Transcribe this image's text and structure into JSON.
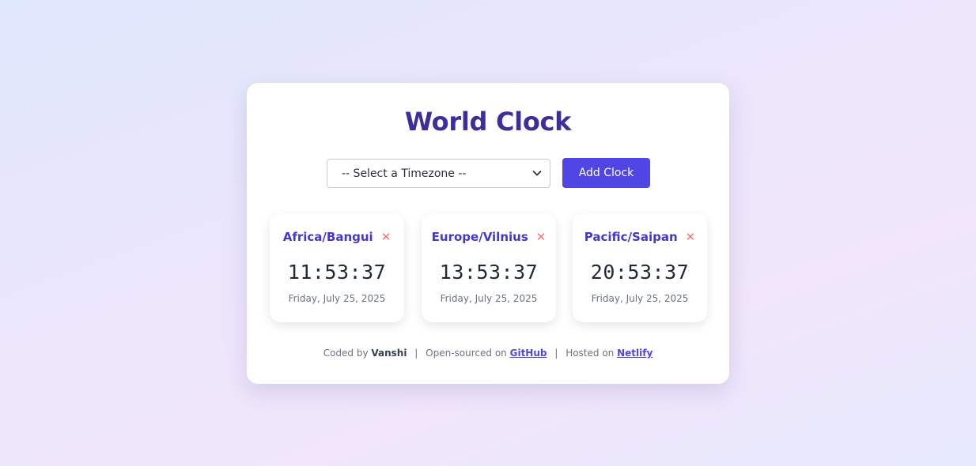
{
  "title": "World Clock",
  "controls": {
    "select_value": "-- Select a Timezone --",
    "add_label": "Add Clock"
  },
  "clocks": [
    {
      "zone": "Africa/Bangui",
      "time": "11:53:37",
      "date": "Friday, July 25, 2025"
    },
    {
      "zone": "Europe/Vilnius",
      "time": "13:53:37",
      "date": "Friday, July 25, 2025"
    },
    {
      "zone": "Pacific/Saipan",
      "time": "20:53:37",
      "date": "Friday, July 25, 2025"
    }
  ],
  "remove_glyph": "✕",
  "footer": {
    "coded_prefix": "Coded by",
    "author": "Vanshi",
    "separator": "|",
    "open_prefix": "Open-sourced on",
    "github_label": "GitHub",
    "hosted_prefix": "Hosted on",
    "netlify_label": "Netlify"
  },
  "colors": {
    "accent": "#4f46e5",
    "title": "#3b2f9e",
    "remove": "#f87171"
  },
  "icons": {
    "remove": "close-icon",
    "select_chevron": "chevron-down-icon"
  }
}
